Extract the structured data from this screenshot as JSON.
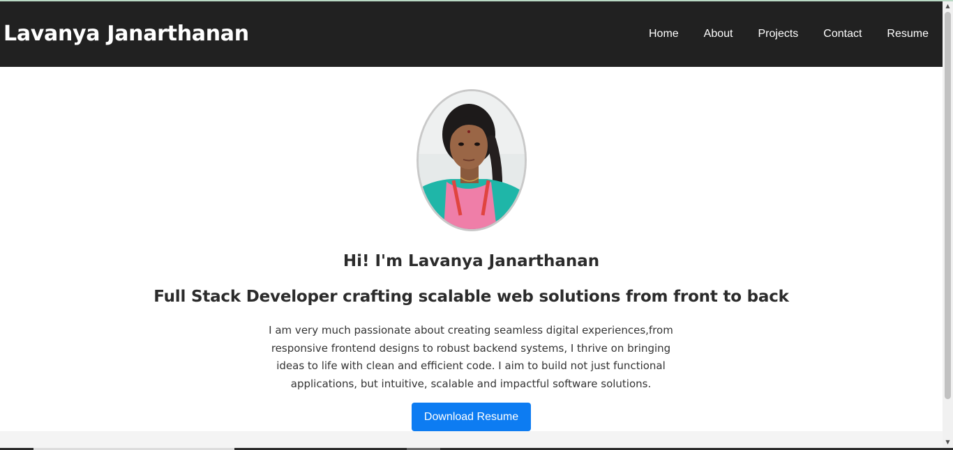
{
  "header": {
    "brand": "Lavanya Janarthanan",
    "nav": [
      {
        "label": "Home"
      },
      {
        "label": "About"
      },
      {
        "label": "Projects"
      },
      {
        "label": "Contact"
      },
      {
        "label": "Resume"
      }
    ]
  },
  "hero": {
    "greeting": "Hi! I'm Lavanya Janarthanan",
    "tagline": "Full Stack Developer crafting scalable web solutions from front to back",
    "bio": "I am very much passionate about creating seamless digital experiences,from responsive frontend designs to robust backend systems, I thrive on bringing ideas to life with clean and efficient code. I aim to build not just functional applications, but intuitive, scalable and impactful software solutions.",
    "download_label": "Download Resume"
  },
  "colors": {
    "navbar_bg": "#212121",
    "button_bg": "#0d7cf2",
    "text_dark": "#2b2b2b"
  },
  "icons": {
    "scroll_up": "chevron-up-icon",
    "scroll_down": "chevron-down-icon"
  }
}
